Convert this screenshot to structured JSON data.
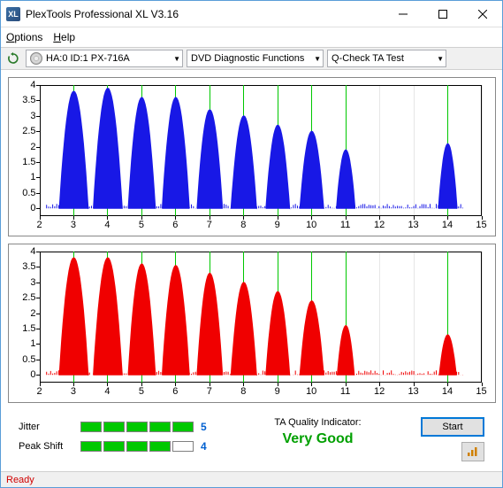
{
  "window": {
    "title": "PlexTools Professional XL V3.16",
    "logo_text": "XL"
  },
  "menu": {
    "options": "Options",
    "help": "Help"
  },
  "toolbar": {
    "device": "HA:0 ID:1  PX-716A",
    "category": "DVD Diagnostic Functions",
    "test": "Q-Check TA Test"
  },
  "chart_data": [
    {
      "type": "bar",
      "color": "#1818e6",
      "xlabel": "",
      "ylabel": "",
      "xlim": [
        2,
        15
      ],
      "ylim": [
        -0.25,
        4
      ],
      "xticks": [
        2,
        3,
        4,
        5,
        6,
        7,
        8,
        9,
        10,
        11,
        12,
        13,
        14,
        15
      ],
      "yticks": [
        0,
        0.5,
        1,
        1.5,
        2,
        2.5,
        3,
        3.5,
        4
      ],
      "peaks_x": [
        3,
        4,
        5,
        6,
        7,
        8,
        9,
        10,
        11,
        14
      ],
      "series": [
        {
          "center": 3,
          "height": 3.8,
          "width": 0.85
        },
        {
          "center": 4,
          "height": 3.9,
          "width": 0.85
        },
        {
          "center": 5,
          "height": 3.6,
          "width": 0.8
        },
        {
          "center": 6,
          "height": 3.6,
          "width": 0.8
        },
        {
          "center": 7,
          "height": 3.2,
          "width": 0.75
        },
        {
          "center": 8,
          "height": 3.0,
          "width": 0.75
        },
        {
          "center": 9,
          "height": 2.7,
          "width": 0.7
        },
        {
          "center": 10,
          "height": 2.5,
          "width": 0.7
        },
        {
          "center": 11,
          "height": 1.9,
          "width": 0.55
        },
        {
          "center": 14,
          "height": 2.1,
          "width": 0.55
        }
      ]
    },
    {
      "type": "bar",
      "color": "#f00000",
      "xlabel": "",
      "ylabel": "",
      "xlim": [
        2,
        15
      ],
      "ylim": [
        -0.25,
        4
      ],
      "xticks": [
        2,
        3,
        4,
        5,
        6,
        7,
        8,
        9,
        10,
        11,
        12,
        13,
        14,
        15
      ],
      "yticks": [
        0,
        0.5,
        1,
        1.5,
        2,
        2.5,
        3,
        3.5,
        4
      ],
      "peaks_x": [
        3,
        4,
        5,
        6,
        7,
        8,
        9,
        10,
        11,
        14
      ],
      "series": [
        {
          "center": 3,
          "height": 3.8,
          "width": 0.85
        },
        {
          "center": 4,
          "height": 3.8,
          "width": 0.85
        },
        {
          "center": 5,
          "height": 3.6,
          "width": 0.8
        },
        {
          "center": 6,
          "height": 3.55,
          "width": 0.8
        },
        {
          "center": 7,
          "height": 3.3,
          "width": 0.75
        },
        {
          "center": 8,
          "height": 3.0,
          "width": 0.75
        },
        {
          "center": 9,
          "height": 2.7,
          "width": 0.7
        },
        {
          "center": 10,
          "height": 2.4,
          "width": 0.7
        },
        {
          "center": 11,
          "height": 1.6,
          "width": 0.5
        },
        {
          "center": 14,
          "height": 1.3,
          "width": 0.5
        }
      ]
    }
  ],
  "metrics": {
    "jitter_label": "Jitter",
    "jitter_value": "5",
    "jitter_bars": 5,
    "peakshift_label": "Peak Shift",
    "peakshift_value": "4",
    "peakshift_bars": 4,
    "max_bars": 5
  },
  "ta": {
    "label": "TA Quality Indicator:",
    "value": "Very Good"
  },
  "buttons": {
    "start": "Start"
  },
  "status": "Ready"
}
